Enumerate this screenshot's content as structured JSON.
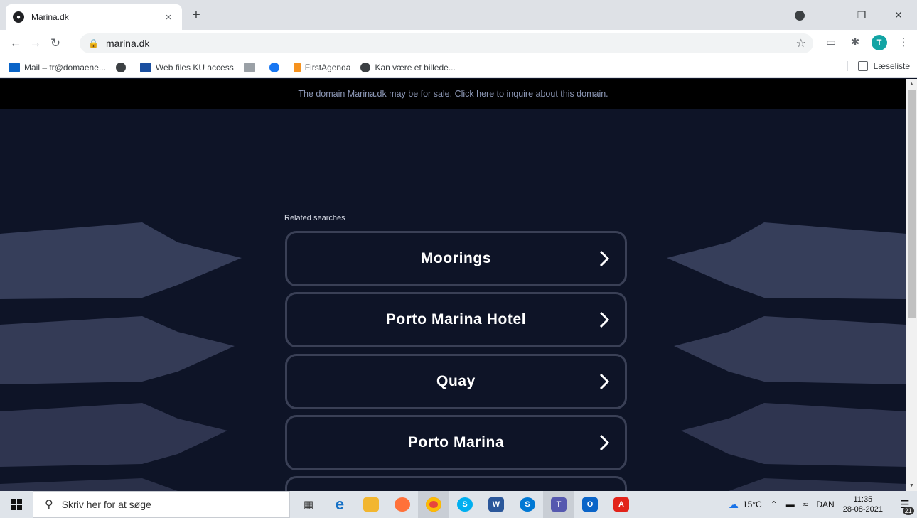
{
  "browser": {
    "tab_title": "Marina.dk",
    "tab_close": "×",
    "new_tab": "+",
    "url": "marina.dk",
    "bookmarks": [
      {
        "label": "Mail – tr@domaene..."
      },
      {
        "label": ""
      },
      {
        "label": "Web files KU access"
      },
      {
        "label": ""
      },
      {
        "label": ""
      },
      {
        "label": "FirstAgenda"
      },
      {
        "label": "Kan være et billede..."
      }
    ],
    "reading_list": "Læseliste",
    "avatar_initial": "T"
  },
  "page": {
    "banner": "The domain Marina.dk may be for sale. Click here to inquire about this domain.",
    "related_label": "Related searches",
    "searches": [
      {
        "label": "Moorings"
      },
      {
        "label": "Porto Marina Hotel"
      },
      {
        "label": "Quay"
      },
      {
        "label": "Porto Marina"
      },
      {
        "label": ""
      }
    ]
  },
  "taskbar": {
    "search_placeholder": "Skriv her for at søge",
    "weather": "15°C",
    "language": "DAN",
    "time": "11:35",
    "date": "28-08-2021",
    "notification_count": "21"
  },
  "colors": {
    "page_bg": "#0e1427",
    "banner_bg": "#000000",
    "banner_text": "#8c97b5",
    "button_border": "#3a4056",
    "deco_shape": "#3b4360"
  }
}
